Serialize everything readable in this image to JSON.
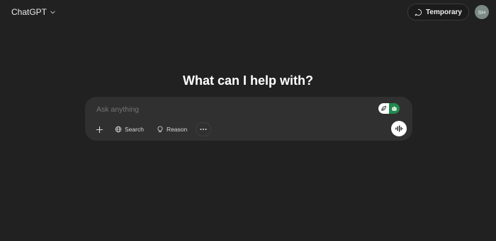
{
  "header": {
    "model_label": "ChatGPT",
    "temporary_label": "Temporary",
    "avatar_initials": "SH"
  },
  "main": {
    "headline": "What can I help with?"
  },
  "composer": {
    "placeholder": "Ask anything",
    "tools": {
      "search_label": "Search",
      "reason_label": "Reason"
    }
  },
  "icons": {
    "model_chevron": "chevron-down-icon",
    "temporary": "temporary-chat-icon",
    "plus": "plus-icon",
    "search": "globe-icon",
    "reason": "lightbulb-icon",
    "more": "more-icon",
    "voice": "voice-waveform-icon",
    "extension_a": "leaf-icon",
    "extension_b": "robot-icon"
  },
  "colors": {
    "background": "#212121",
    "composer": "#303030",
    "extension_green": "#1f8a4c",
    "avatar": "#7b8a86"
  }
}
